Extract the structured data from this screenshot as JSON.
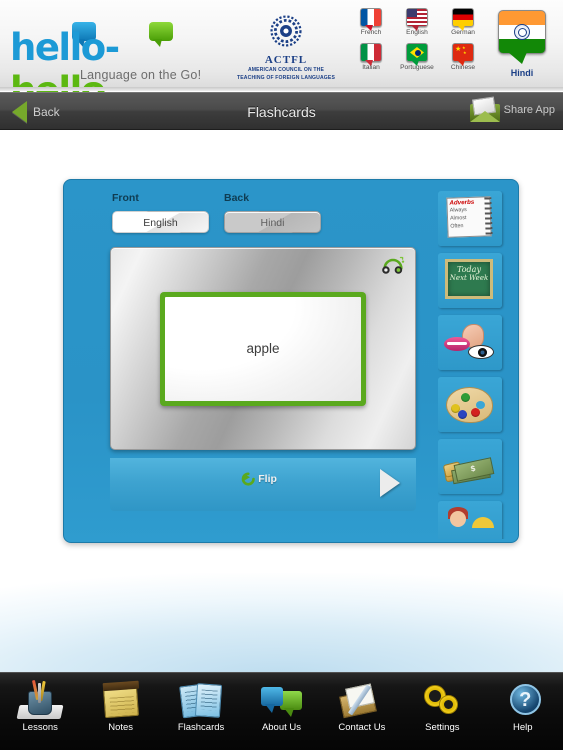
{
  "header": {
    "logo": {
      "part1": "hello",
      "dash": "-",
      "part2": "hello",
      "tagline": "Language on the Go!"
    },
    "actfl": {
      "name": "ACTFL",
      "line1": "AMERICAN COUNCIL ON THE",
      "line2": "TEACHING OF FOREIGN LANGUAGES"
    },
    "languages": [
      {
        "label": "French",
        "icon": "flag-france-icon"
      },
      {
        "label": "English",
        "icon": "flag-usa-icon"
      },
      {
        "label": "German",
        "icon": "flag-germany-icon"
      },
      {
        "label": "Italian",
        "icon": "flag-italy-icon"
      },
      {
        "label": "Portuguese",
        "icon": "flag-brazil-icon"
      },
      {
        "label": "Chinese",
        "icon": "flag-china-icon"
      }
    ],
    "selected_language": {
      "label": "Hindi",
      "icon": "flag-india-icon"
    }
  },
  "navbar": {
    "back_label": "Back",
    "back_icon": "triangle-left-icon",
    "title": "Flashcards",
    "share_label": "Share App",
    "share_icon": "envelope-icon"
  },
  "flashcard_panel": {
    "front_label": "Front",
    "back_label": "Back",
    "front_value": "English",
    "back_value": "Hindi",
    "audio_icon": "headphones-icon",
    "card_word": "apple",
    "flip_label": "Flip",
    "flip_icon": "refresh-arrow-icon",
    "next_icon": "play-triangle-icon",
    "accent_blue": "#2b95c9",
    "card_border_green": "#5aa91e",
    "thumbnails": [
      {
        "name": "adverbs-notepad-thumb",
        "title": "Adverbs",
        "lines": [
          "Always",
          "Almost",
          "Often"
        ]
      },
      {
        "name": "time-chalkboard-thumb",
        "line1": "Today",
        "line2": "Next Week"
      },
      {
        "name": "senses-thumb"
      },
      {
        "name": "colors-palette-thumb"
      },
      {
        "name": "money-thumb"
      },
      {
        "name": "people-thumb"
      }
    ]
  },
  "toolbar": {
    "items": [
      {
        "label": "Lessons",
        "icon": "pencil-cup-icon",
        "active": false
      },
      {
        "label": "Notes",
        "icon": "notepad-icon",
        "active": false
      },
      {
        "label": "Flashcards",
        "icon": "flashcards-icon",
        "active": true
      },
      {
        "label": "About Us",
        "icon": "speech-bubbles-icon",
        "active": false
      },
      {
        "label": "Contact Us",
        "icon": "envelope-pen-icon",
        "active": false
      },
      {
        "label": "Settings",
        "icon": "gears-icon",
        "active": false
      },
      {
        "label": "Help",
        "icon": "question-mark-icon",
        "active": false
      }
    ]
  }
}
